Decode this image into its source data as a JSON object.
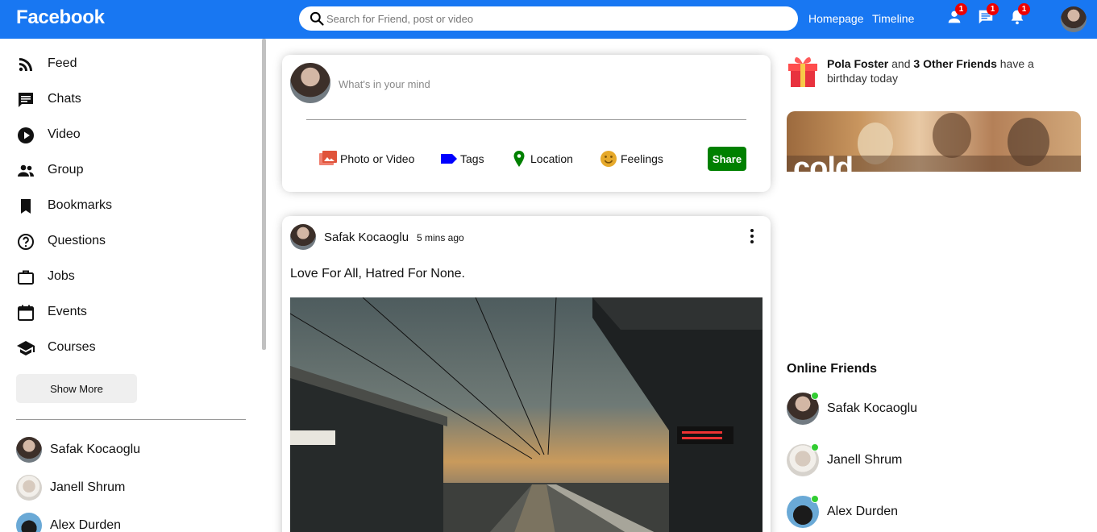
{
  "topbar": {
    "logo": "Facebook",
    "search_placeholder": "Search for Friend, post or video",
    "links": [
      "Homepage",
      "Timeline"
    ],
    "badges": {
      "friends": "1",
      "messages": "1",
      "notifications": "1"
    },
    "brand_color": "#1877f2"
  },
  "sidebar": {
    "items": [
      {
        "label": "Feed",
        "icon": "rss-feed-icon"
      },
      {
        "label": "Chats",
        "icon": "chat-icon"
      },
      {
        "label": "Video",
        "icon": "play-circle-icon"
      },
      {
        "label": "Group",
        "icon": "group-icon"
      },
      {
        "label": "Bookmarks",
        "icon": "bookmark-icon"
      },
      {
        "label": "Questions",
        "icon": "help-circle-icon"
      },
      {
        "label": "Jobs",
        "icon": "briefcase-icon"
      },
      {
        "label": "Events",
        "icon": "calendar-icon"
      },
      {
        "label": "Courses",
        "icon": "school-icon"
      }
    ],
    "show_more": "Show More",
    "friends": [
      "Safak Kocaoglu",
      "Janell Shrum",
      "Alex Durden"
    ]
  },
  "share": {
    "placeholder": "What's in your mind",
    "options": [
      "Photo or Video",
      "Tags",
      "Location",
      "Feelings"
    ],
    "button": "Share"
  },
  "post": {
    "username": "Safak Kocaoglu",
    "time": "5 mins ago",
    "text": "Love For All, Hatred For None."
  },
  "rightbar": {
    "birthday_name": "Pola Foster",
    "birthday_and": "and",
    "birthday_others": "3 Other Friends",
    "birthday_rest": "have a birthday today",
    "ad_text": "cold",
    "online_title": "Online Friends",
    "online_friends": [
      "Safak Kocaoglu",
      "Janell Shrum",
      "Alex Durden"
    ]
  }
}
